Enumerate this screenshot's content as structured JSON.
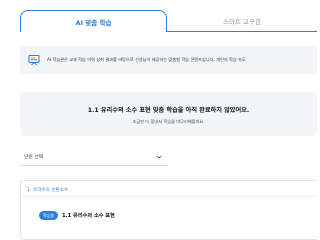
{
  "tabs": [
    {
      "label": "AI 맞춤 학습",
      "active": true
    },
    {
      "label": "스마트 교구관",
      "active": false
    }
  ],
  "notice": {
    "icon": "presentation-board-icon",
    "text": "AI 학습관은 교과 학습 이력 성취 결과를 바탕으로 선생님이 제공하는 맞춤형 학습 콘텐츠입니다. 개인의 학습 속도"
  },
  "status": {
    "title": "1.1 유리수의 소수 표현 맞춤 학습을 아직 완료하지 않았어요.",
    "subtitle": "조금만 더 힘내서 학습을 마무리해볼까요."
  },
  "unit_select": {
    "value": "단원 선택",
    "icon": "chevron-down-icon"
  },
  "section": {
    "title": "1. 유리수의 순환소수",
    "lesson": {
      "badge": "학습중",
      "label": "1.1 유리수의 소수 표현"
    }
  },
  "colors": {
    "accent": "#2f7fd8",
    "panel_bg": "#f3f5f8"
  }
}
